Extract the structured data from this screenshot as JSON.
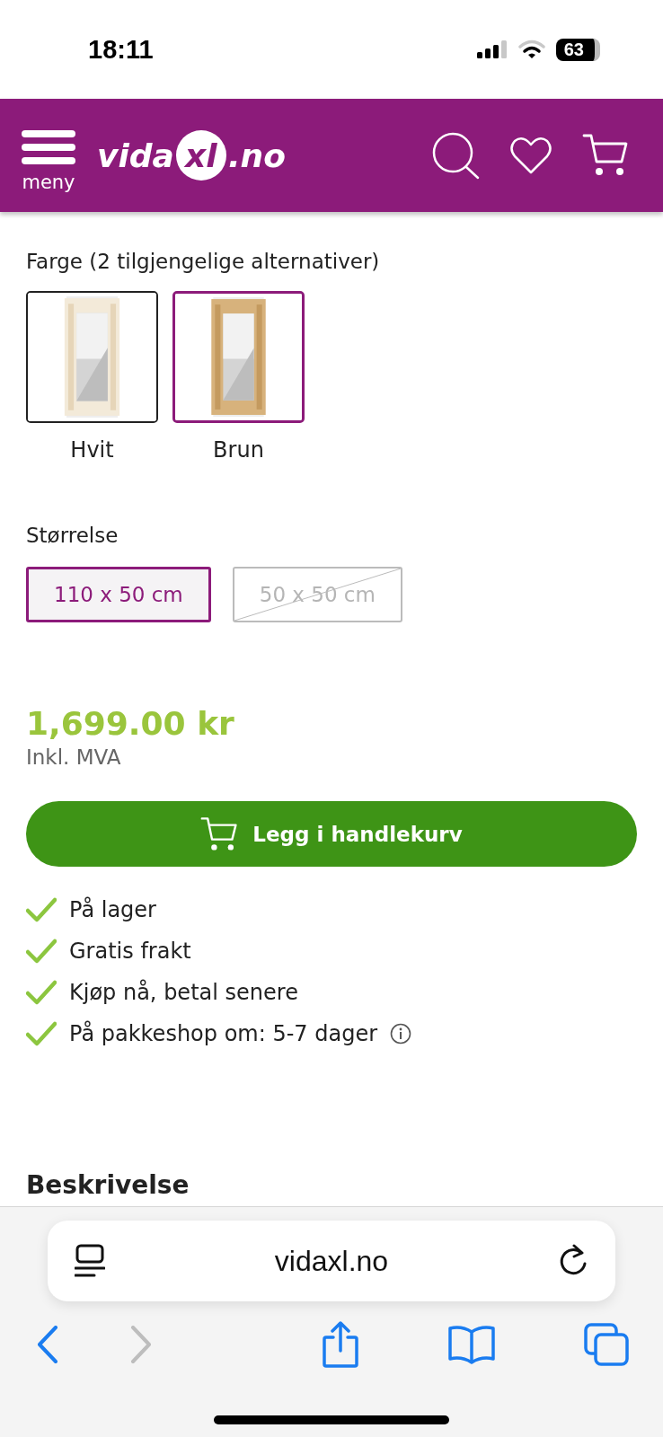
{
  "status_bar": {
    "time": "18:11",
    "battery": "63"
  },
  "header": {
    "menu_label": "meny",
    "logo": {
      "before": "vida",
      "mark": "xl",
      "after": ".no"
    }
  },
  "color_option": {
    "label": "Farge (2 tilgjengelige alternativer)",
    "swatches": [
      {
        "name": "Hvit",
        "selected": false,
        "kind": "picture"
      },
      {
        "name": "Brun",
        "selected": true,
        "kind": "picture"
      }
    ]
  },
  "size_option": {
    "label": "Størrelse",
    "sizes": [
      {
        "label": "110 x 50 cm",
        "selected": true,
        "available": true
      },
      {
        "label": "50 x 50 cm",
        "selected": false,
        "available": false
      }
    ]
  },
  "price": {
    "amount": "1,699.00 kr",
    "note": "Inkl. MVA"
  },
  "add_to_cart": "Legg i handlekurv",
  "benefits": [
    {
      "text": "På lager",
      "info": false
    },
    {
      "text": "Gratis frakt",
      "info": false
    },
    {
      "text": "Kjøp nå, betal senere",
      "info": false
    },
    {
      "text": "På pakkeshop om: 5-7 dager",
      "info": true
    }
  ],
  "section_heading": "Beskrivelse",
  "browser": {
    "url": "vidaxl.no"
  }
}
